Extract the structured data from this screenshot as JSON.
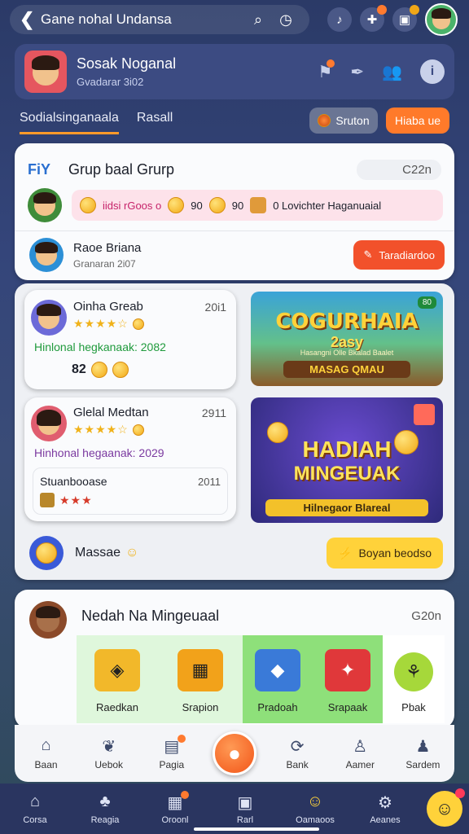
{
  "topbar": {
    "title": "Gane nohal Undansa"
  },
  "profile": {
    "name": "Sosak Noganal",
    "sub": "Gvadarar 3i02"
  },
  "tabs": [
    "Sodialsinganaala",
    "Rasall"
  ],
  "buttons": {
    "status": "Sruton",
    "action": "Hiaba ue"
  },
  "group": {
    "logo_text": "FiY",
    "title": "Grup baal Grurp",
    "time": "C22n",
    "stats": [
      "iidsi rGoos o",
      "90",
      "90",
      "0 Lovichter Haganuaial"
    ],
    "member": {
      "name": "Raoe Briana",
      "sub": "Granaran 2i07",
      "button": "Taradiardoo"
    }
  },
  "posts": [
    {
      "name": "Oinha Greab",
      "time": "20i1",
      "text": "Hinlonal hegkanaak: 2082",
      "count": "82"
    },
    {
      "name": "Glelal Medtan",
      "time": "2911",
      "text": "Hinhonal hegaanak: 2029",
      "reply_name": "Stuanbooase",
      "reply_time": "2011"
    }
  ],
  "banners": [
    {
      "title": "COGURHAIA",
      "sub": "2asy",
      "small": "Hasangni Olle Bkalad Baalet",
      "footer": "MASAG QMAU",
      "badge": "80"
    },
    {
      "title": "HADIAH",
      "title2": "MINGEUAK",
      "footer": "Hilnegaor Blareal"
    }
  ],
  "massage": {
    "label": "Massae",
    "button": "Boyan beodso"
  },
  "shop": {
    "title": "Nedah Na Mingeuaal",
    "time": "G20n",
    "items": [
      "Raedkan",
      "Srapion",
      "Pradoah",
      "Srapaak",
      "Pbak"
    ]
  },
  "nav1": [
    "Baan",
    "Uebok",
    "Pagia",
    "",
    "Bank",
    "Aamer",
    "Sardem"
  ],
  "nav2": [
    "Corsa",
    "Reagia",
    "Oroonl",
    "Rarl",
    "Oamaoos",
    "Aeanes"
  ],
  "colors": {
    "accent": "#ff6a1f",
    "bg": "#2b3a67",
    "green": "#1f9a3c",
    "yellow": "#ffd23a"
  }
}
